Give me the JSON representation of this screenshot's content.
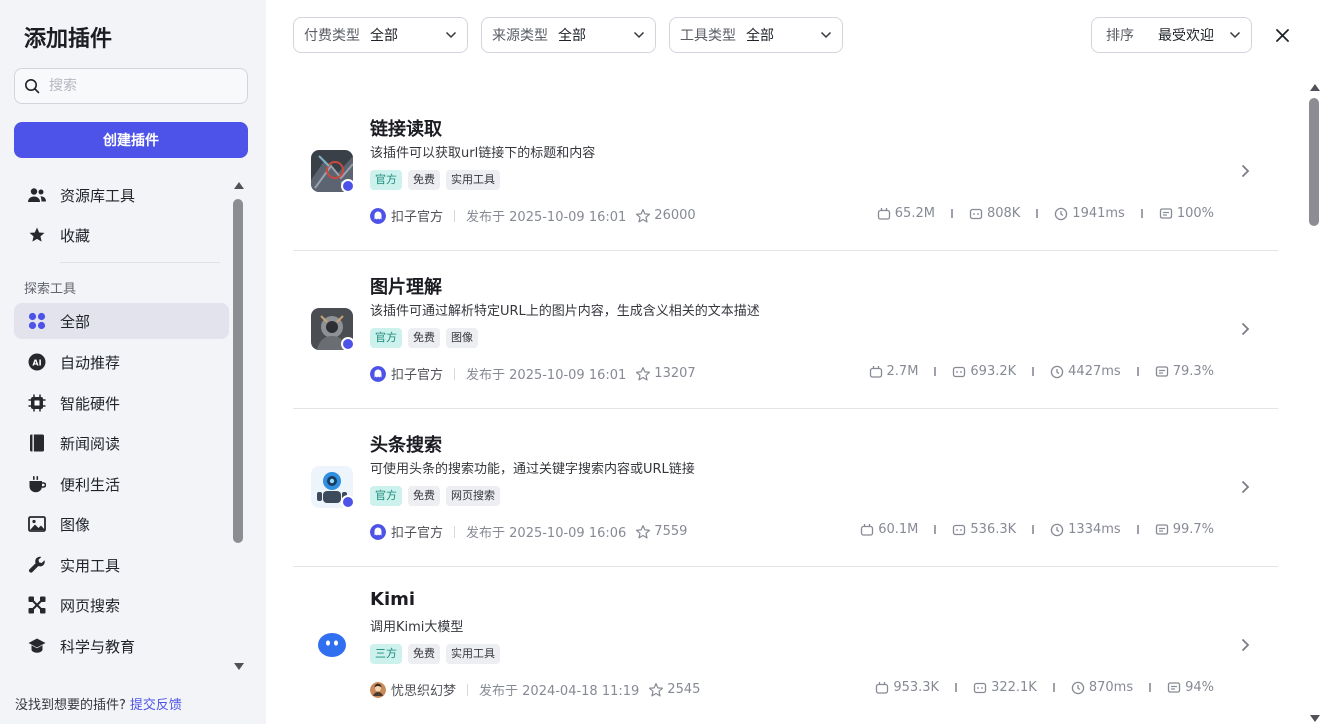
{
  "sidebar": {
    "title": "添加插件",
    "search_placeholder": "搜索",
    "create_label": "创建插件",
    "primary_items": [
      {
        "label": "资源库工具",
        "icon": "users-icon"
      },
      {
        "label": "收藏",
        "icon": "star-icon"
      }
    ],
    "section_label": "探索工具",
    "explore_items": [
      {
        "label": "全部",
        "icon": "grid-icon",
        "active": true
      },
      {
        "label": "自动推荐",
        "icon": "ai-icon"
      },
      {
        "label": "智能硬件",
        "icon": "chip-icon"
      },
      {
        "label": "新闻阅读",
        "icon": "book-icon"
      },
      {
        "label": "便利生活",
        "icon": "cup-icon"
      },
      {
        "label": "图像",
        "icon": "image-icon"
      },
      {
        "label": "实用工具",
        "icon": "wrench-icon"
      },
      {
        "label": "网页搜索",
        "icon": "network-icon"
      },
      {
        "label": "科学与教育",
        "icon": "graduation-cap-icon"
      }
    ],
    "footer_text": "没找到想要的插件?",
    "footer_link": "提交反馈"
  },
  "filters": [
    {
      "label": "付费类型",
      "value": "全部"
    },
    {
      "label": "来源类型",
      "value": "全部"
    },
    {
      "label": "工具类型",
      "value": "全部"
    }
  ],
  "sort": {
    "label": "排序",
    "value": "最受欢迎"
  },
  "plugins": [
    {
      "name": "链接读取",
      "description": "该插件可以获取url链接下的标题和内容",
      "tags": [
        "官方",
        "免费",
        "实用工具"
      ],
      "author": "扣子官方",
      "published": "发布于 2025-10-09 16:01",
      "favorites": "26000",
      "bots": "65.2M",
      "calls": "808K",
      "latency": "1941ms",
      "success": "100%"
    },
    {
      "name": "图片理解",
      "description": "该插件可通过解析特定URL上的图片内容，生成含义相关的文本描述",
      "tags": [
        "官方",
        "免费",
        "图像"
      ],
      "author": "扣子官方",
      "published": "发布于 2025-10-09 16:01",
      "favorites": "13207",
      "bots": "2.7M",
      "calls": "693.2K",
      "latency": "4427ms",
      "success": "79.3%"
    },
    {
      "name": "头条搜索",
      "description": "可使用头条的搜索功能，通过关键字搜索内容或URL链接",
      "tags": [
        "官方",
        "免费",
        "网页搜索"
      ],
      "author": "扣子官方",
      "published": "发布于 2025-10-09 16:06",
      "favorites": "7559",
      "bots": "60.1M",
      "calls": "536.3K",
      "latency": "1334ms",
      "success": "99.7%"
    },
    {
      "name": "Kimi",
      "description": "调用Kimi大模型",
      "tags": [
        "三方",
        "免费",
        "实用工具"
      ],
      "author": "忧思织幻梦",
      "published": "发布于 2024-04-18 11:19",
      "favorites": "2545",
      "bots": "953.3K",
      "calls": "322.1K",
      "latency": "870ms",
      "success": "94%"
    }
  ],
  "colors": {
    "accent": "#4d53e8",
    "official_tag_bg": "#cdf1ec",
    "official_tag_text": "#1a8a7b",
    "sidebar_bg": "#f3f4f8"
  }
}
